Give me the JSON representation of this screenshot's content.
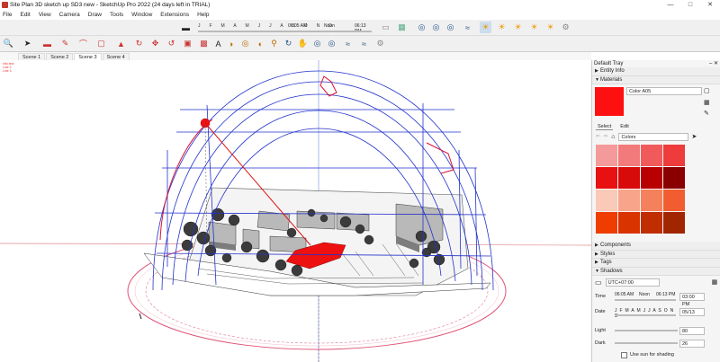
{
  "window": {
    "title": "Site Plan 3D sketch up SD3 new - SketchUp Pro 2022 (24 days left in TRIAL)"
  },
  "menu": [
    "File",
    "Edit",
    "View",
    "Camera",
    "Draw",
    "Tools",
    "Window",
    "Extensions",
    "Help"
  ],
  "timebar": {
    "months": "J F M A M J J A S O N D",
    "time_start": "06:05 AM",
    "time_mid": "Noon",
    "time_end": "06:13 PM"
  },
  "scenes": [
    "Scene 1",
    "Scene 2",
    "Scene 3",
    "Scene 4"
  ],
  "active_scene": "Scene 3",
  "viewport": {
    "info_lines": [
      "Info text",
      "Line 2",
      "Line 3"
    ]
  },
  "tray": {
    "title": "Default Tray",
    "entity_info": "Entity Info",
    "materials": {
      "title": "Materials",
      "material_name": "Color A05",
      "swatch_color": "#ff1010",
      "select_tab": "Select",
      "edit_tab": "Edit",
      "library": "Colors",
      "grid": [
        "#f59a9a",
        "#f27a7a",
        "#f05a5a",
        "#ee3b3b",
        "#e81010",
        "#d80a0a",
        "#b80000",
        "#8a0000",
        "#fbc9b8",
        "#f8a48a",
        "#f5805c",
        "#f15d30",
        "#ef3c00",
        "#d93300",
        "#bf2d00",
        "#a12600"
      ]
    },
    "components": "Components",
    "styles": "Styles",
    "tags": "Tags",
    "shadows": {
      "title": "Shadows",
      "utc": "UTC+07:00",
      "time_label": "Time",
      "time_start": "06:05 AM",
      "time_mid": "Noon",
      "time_end": "06:13 PM",
      "time_value": "03:00 PM",
      "date_label": "Date",
      "date_months": "J F M A M J J A S O N D",
      "date_value": "05/13",
      "light_label": "Light",
      "light_value": "80",
      "dark_label": "Dark",
      "dark_value": "26",
      "sun_shading": "Use sun for shading"
    }
  },
  "colors": {
    "accent": "#ff1010",
    "dome_blue": "#2233cc",
    "dome_red": "#dd1133"
  }
}
